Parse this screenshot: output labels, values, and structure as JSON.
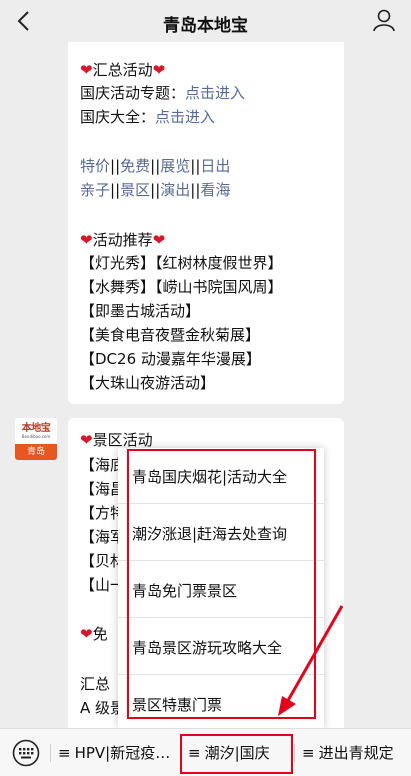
{
  "header": {
    "title": "青岛本地宝",
    "back_icon": "back-chevron-icon",
    "profile_icon": "user-profile-icon"
  },
  "message1": {
    "section_title": "汇总活动",
    "topic_label": "国庆活动专题：",
    "topic_link": "点击进入",
    "guide_label": "国庆大全：",
    "guide_link": "点击进入",
    "category_row1": [
      "特价",
      "免费",
      "展览",
      "日出"
    ],
    "category_row2": [
      "亲子",
      "景区",
      "演出",
      "看海"
    ],
    "separator": "||",
    "recommend_title": "活动推荐",
    "recommendations": [
      "【灯光秀】【红树林度假世界】",
      "【水舞秀】【崂山书院国风周】",
      "【即墨古城活动】",
      "【美食电音夜暨金秋菊展】",
      "【DC26 动漫嘉年华漫展】",
      "【大珠山夜游活动】"
    ]
  },
  "avatar": {
    "brand": "本地宝",
    "site": "Bendibao.com",
    "city": "青岛"
  },
  "message2": {
    "section_title": "景区活动",
    "items_partial": [
      "【海底",
      "【海昌",
      "【方特",
      "【海军",
      "【贝林",
      "【山一"
    ],
    "free_partial": "免",
    "summary_partial": "汇总",
    "grade_partial": "A 级景"
  },
  "heart_glyph": "❤",
  "popup_menu": {
    "items": [
      "青岛国庆烟花|活动大全",
      "潮汐涨退|赶海去处查询",
      "青岛免门票景区",
      "青岛景区游玩攻略大全",
      "景区特惠门票"
    ]
  },
  "bottom_bar": {
    "keyboard_icon": "keyboard-icon",
    "menu_glyph": "≡",
    "tabs": [
      "HPV|新冠疫…",
      "潮汐|国庆",
      "进出青规定"
    ]
  },
  "colors": {
    "link": "#576b95",
    "heart": "#d7162a",
    "highlight": "#e3001b"
  }
}
